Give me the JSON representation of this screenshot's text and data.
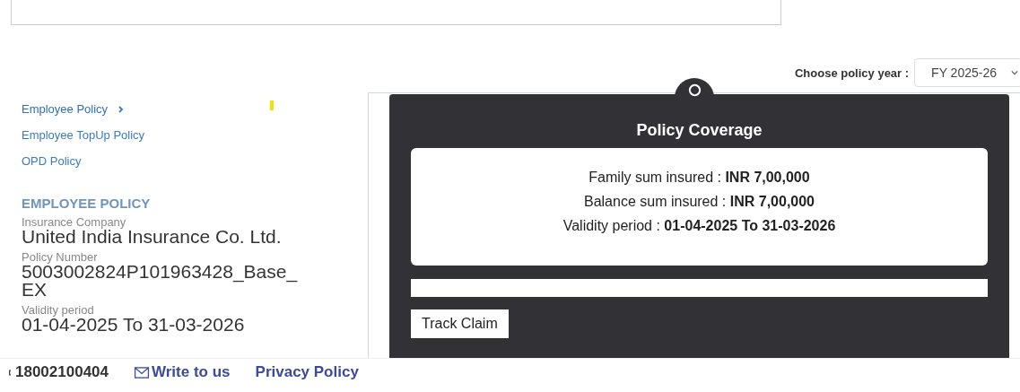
{
  "policy_year": {
    "label": "Choose policy year :",
    "value": "FY 2025-26"
  },
  "sidebar": {
    "items": [
      {
        "label": "Employee Policy",
        "selected": true
      },
      {
        "label": "Employee TopUp Policy",
        "selected": false
      },
      {
        "label": "OPD Policy",
        "selected": false
      }
    ]
  },
  "policy_details": {
    "heading": "EMPLOYEE POLICY",
    "fields": [
      {
        "label": "Insurance Company",
        "value": "United India Insurance Co. Ltd."
      },
      {
        "label": "Policy Number",
        "value": "5003002824P101963428_Base_ EX"
      },
      {
        "label": "Validity period",
        "value": "01-04-2025 To 31-03-2026"
      }
    ]
  },
  "coverage": {
    "title": "Policy Coverage",
    "lines": [
      "Family sum insured : **INR 7,00,000**",
      "Balance sum insured : **INR 7,00,000**",
      "Validity period : **01-04-2025 To 31-03-2026**"
    ],
    "button": "Track Claim"
  },
  "footer": {
    "phone": "18002100404",
    "email_link": "Write to us",
    "privacy_link": "Privacy Policy"
  }
}
